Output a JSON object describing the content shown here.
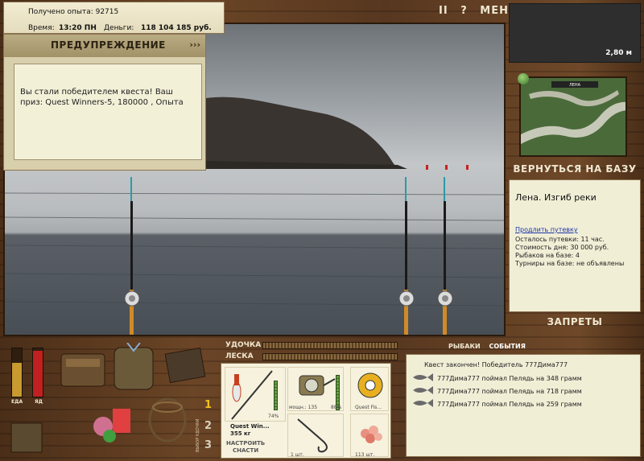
{
  "stats": {
    "xp_line": "Получено опыта: 92715",
    "time_label": "Время:",
    "time_value": "13:20 ПН",
    "money_label": "Деньги:",
    "money_value": "118 104 185 руб."
  },
  "top_menu": {
    "pause": "II",
    "help": "?",
    "menu": "МЕНЮ"
  },
  "warning": {
    "title": "ПРЕДУПРЕЖДЕНИЕ",
    "arrows": "›››",
    "message": "Вы стали победителем квеста! Ваш приз: Quest Winners-5, 180000 , Опыта"
  },
  "depth": {
    "value": "2,80 м"
  },
  "base": {
    "back_label": "ВЕРНУТЬСЯ НА БАЗУ",
    "location_name": "Лена. Изгиб реки",
    "extend_link": "Продлить путевку",
    "remaining": "Осталось путевки: 11 час.",
    "day_cost": "Стоимость дня: 30 000 руб.",
    "fishers": "Рыбаков на базе: 4",
    "tournaments": "Турниры на базе: не объявлены",
    "bans_label": "ЗАПРЕТЫ"
  },
  "tackle": {
    "rod_label": "УДОЧКА",
    "line_label": "ЛЕСКА"
  },
  "tabs": {
    "fishers": "РЫБАКИ",
    "events": "СОБЫТИЯ"
  },
  "events": {
    "header": "Квест закончен! Победитель 777Дима777",
    "items": [
      "777Дима777 поймал Пелядь на 348 грамм",
      "777Дима777 поймал Пелядь на 718 грамм",
      "777Дима777 поймал Пелядь на 259 грамм"
    ]
  },
  "gear": {
    "rod_name": "Quest Win...",
    "rod_weight": "355 кг",
    "rod_percent": "74%",
    "reel_label": "мощн.: 135",
    "reel_percent": "88%",
    "line_name": "Quest Fis...",
    "hook_count": "1 шт.",
    "bait_count": "113 шт.",
    "configure": "НАСТРОИТЬ",
    "configure2": "СНАСТИ",
    "rod_level": 0.74,
    "reel_level": 0.88
  },
  "sets": {
    "s1": "1",
    "s2": "2",
    "s3": "3",
    "vertical": "ВЫБОР УДОЧКИ"
  },
  "meters": {
    "food_label": "ЕДА",
    "poison_label": "ЯД",
    "food_level": 0.7,
    "poison_level": 0.95
  },
  "colors": {
    "food": "#c89a30",
    "poison": "#c02020",
    "accent_link": "#1a36a8"
  }
}
